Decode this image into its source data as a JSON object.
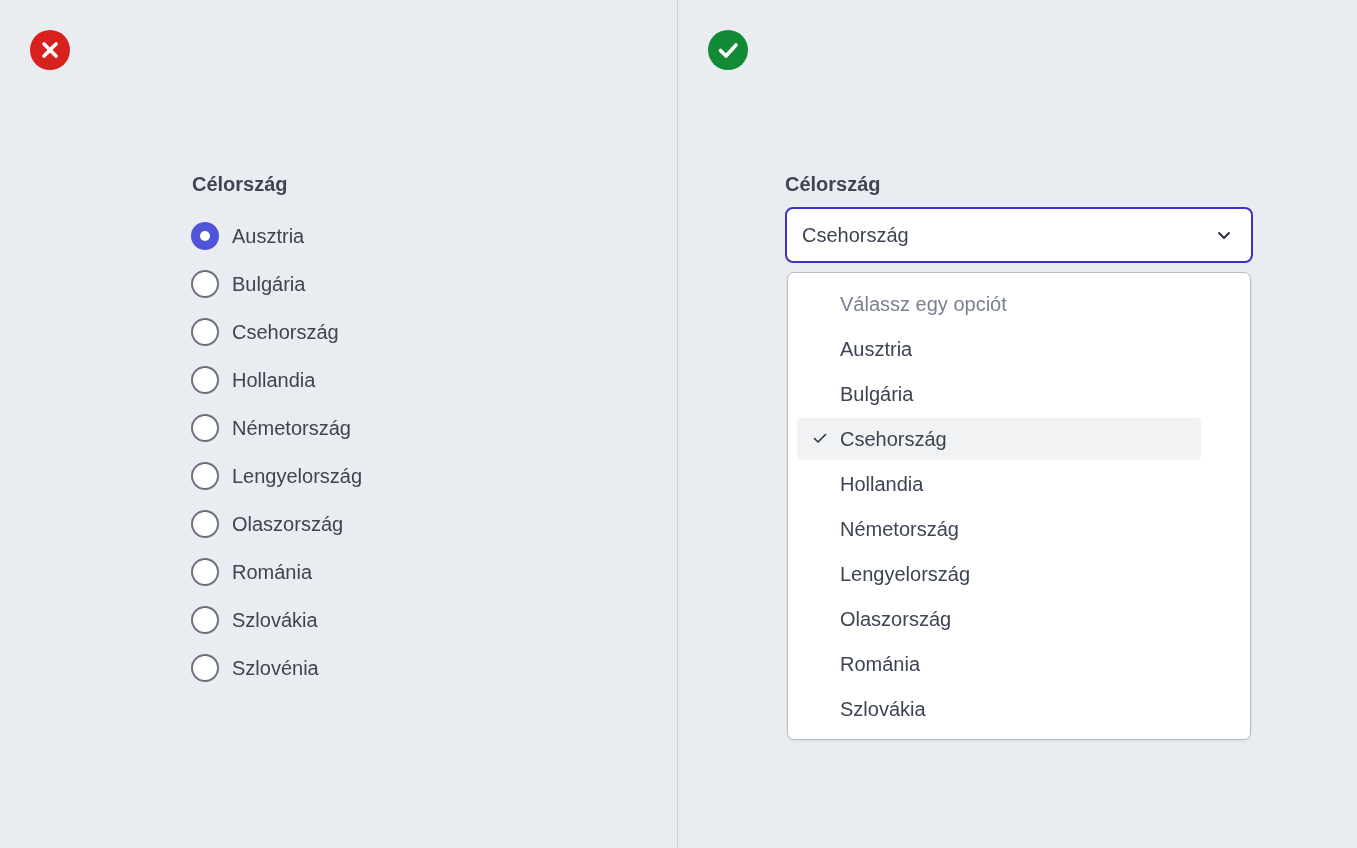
{
  "panels": [
    {
      "correct": false,
      "kind": "radio",
      "label": "Célország",
      "options": [
        {
          "label": "Ausztria",
          "selected": true
        },
        {
          "label": "Bulgária",
          "selected": false
        },
        {
          "label": "Csehország",
          "selected": false
        },
        {
          "label": "Hollandia",
          "selected": false
        },
        {
          "label": "Németország",
          "selected": false
        },
        {
          "label": "Lengyelország",
          "selected": false
        },
        {
          "label": "Olaszország",
          "selected": false
        },
        {
          "label": "Románia",
          "selected": false
        },
        {
          "label": "Szlovákia",
          "selected": false
        },
        {
          "label": "Szlovénia",
          "selected": false
        }
      ]
    },
    {
      "correct": true,
      "kind": "select",
      "label": "Célország",
      "value": "Csehország",
      "expanded": true,
      "prompt_option": "Válassz egy opciót",
      "options": [
        {
          "label": "Ausztria",
          "selected": false
        },
        {
          "label": "Bulgária",
          "selected": false
        },
        {
          "label": "Csehország",
          "selected": true
        },
        {
          "label": "Hollandia",
          "selected": false
        },
        {
          "label": "Németország",
          "selected": false
        },
        {
          "label": "Lengyelország",
          "selected": false
        },
        {
          "label": "Olaszország",
          "selected": false
        },
        {
          "label": "Románia",
          "selected": false
        },
        {
          "label": "Szlovákia",
          "selected": false
        }
      ]
    }
  ]
}
